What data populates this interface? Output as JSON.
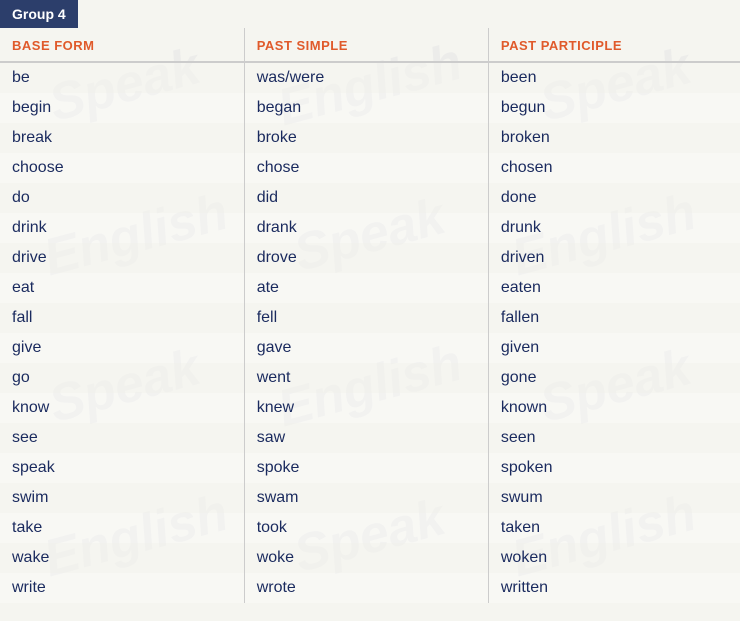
{
  "group": {
    "label": "Group 4"
  },
  "columns": {
    "base": "BASE FORM",
    "past_simple": "PAST SIMPLE",
    "past_participle": "PAST PARTICIPLE"
  },
  "rows": [
    {
      "base": "be",
      "past_simple": "was/were",
      "past_participle": "been"
    },
    {
      "base": "begin",
      "past_simple": "began",
      "past_participle": "begun"
    },
    {
      "base": "break",
      "past_simple": "broke",
      "past_participle": "broken"
    },
    {
      "base": "choose",
      "past_simple": "chose",
      "past_participle": "chosen"
    },
    {
      "base": "do",
      "past_simple": "did",
      "past_participle": "done"
    },
    {
      "base": "drink",
      "past_simple": "drank",
      "past_participle": "drunk"
    },
    {
      "base": "drive",
      "past_simple": "drove",
      "past_participle": "driven"
    },
    {
      "base": "eat",
      "past_simple": "ate",
      "past_participle": "eaten"
    },
    {
      "base": "fall",
      "past_simple": "fell",
      "past_participle": "fallen"
    },
    {
      "base": "give",
      "past_simple": "gave",
      "past_participle": "given"
    },
    {
      "base": "go",
      "past_simple": "went",
      "past_participle": "gone"
    },
    {
      "base": "know",
      "past_simple": "knew",
      "past_participle": "known"
    },
    {
      "base": "see",
      "past_simple": "saw",
      "past_participle": "seen"
    },
    {
      "base": "speak",
      "past_simple": "spoke",
      "past_participle": "spoken"
    },
    {
      "base": "swim",
      "past_simple": "swam",
      "past_participle": "swum"
    },
    {
      "base": "take",
      "past_simple": "took",
      "past_participle": "taken"
    },
    {
      "base": "wake",
      "past_simple": "woke",
      "past_participle": "woken"
    },
    {
      "base": "write",
      "past_simple": "wrote",
      "past_participle": "written"
    }
  ],
  "watermarks": [
    "Speak",
    "English",
    "Speak",
    "English",
    "Speak",
    "English",
    "Speak",
    "English",
    "Speak",
    "English"
  ]
}
